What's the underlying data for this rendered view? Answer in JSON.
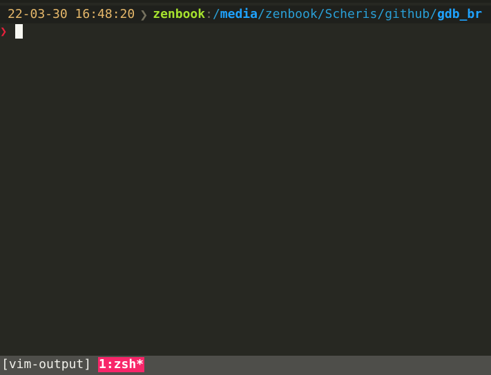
{
  "prompt": {
    "datetime": "22-03-30 16:48:20",
    "separator_icon": "chevron-right-icon",
    "host": "zenbook",
    "path": [
      {
        "text": ":",
        "style": "sep"
      },
      {
        "text": "/",
        "style": "dim"
      },
      {
        "text": "media",
        "style": "bold"
      },
      {
        "text": "/zenbook/Scheris/github/",
        "style": "dim"
      },
      {
        "text": "gdb_br",
        "style": "bold"
      }
    ]
  },
  "input": {
    "prompt_char": "❯",
    "value": ""
  },
  "statusbar": {
    "session": "[vim-output]",
    "window": "1:zsh*"
  },
  "colors": {
    "background": "#272822",
    "datetime": "#e6b86a",
    "host": "#a6e22e",
    "path": "#1fa3ff",
    "prompt_char": "#e8203c",
    "status_bg": "#4e4e4a",
    "active_window": "#f8266a"
  }
}
